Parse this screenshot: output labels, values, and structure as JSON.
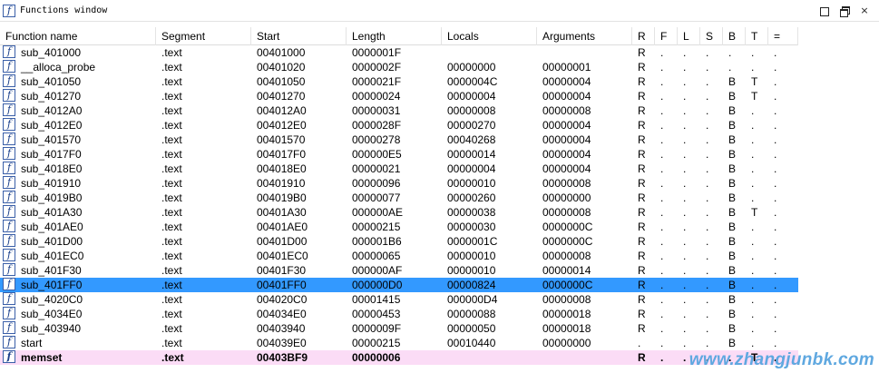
{
  "window": {
    "title": "Functions window",
    "title_icon_glyph": "f",
    "controls": [
      "minimize",
      "restore",
      "close"
    ],
    "close_glyph": "×"
  },
  "columns": [
    "Function name",
    "Segment",
    "Start",
    "Length",
    "Locals",
    "Arguments",
    "R",
    "F",
    "L",
    "S",
    "B",
    "T",
    "="
  ],
  "rows": [
    {
      "name": "sub_401000",
      "segment": ".text",
      "start": "00401000",
      "length": "0000001F",
      "locals": "",
      "arguments": "",
      "R": "R",
      "F": ".",
      "L": ".",
      "S": ".",
      "B": ".",
      "T": ".",
      "eq": "."
    },
    {
      "name": "__alloca_probe",
      "segment": ".text",
      "start": "00401020",
      "length": "0000002F",
      "locals": "00000000",
      "arguments": "00000001",
      "R": "R",
      "F": ".",
      "L": ".",
      "S": ".",
      "B": ".",
      "T": ".",
      "eq": "."
    },
    {
      "name": "sub_401050",
      "segment": ".text",
      "start": "00401050",
      "length": "0000021F",
      "locals": "0000004C",
      "arguments": "00000004",
      "R": "R",
      "F": ".",
      "L": ".",
      "S": ".",
      "B": "B",
      "T": "T",
      "eq": "."
    },
    {
      "name": "sub_401270",
      "segment": ".text",
      "start": "00401270",
      "length": "00000024",
      "locals": "00000004",
      "arguments": "00000004",
      "R": "R",
      "F": ".",
      "L": ".",
      "S": ".",
      "B": "B",
      "T": "T",
      "eq": "."
    },
    {
      "name": "sub_4012A0",
      "segment": ".text",
      "start": "004012A0",
      "length": "00000031",
      "locals": "00000008",
      "arguments": "00000008",
      "R": "R",
      "F": ".",
      "L": ".",
      "S": ".",
      "B": "B",
      "T": ".",
      "eq": "."
    },
    {
      "name": "sub_4012E0",
      "segment": ".text",
      "start": "004012E0",
      "length": "0000028F",
      "locals": "00000270",
      "arguments": "00000004",
      "R": "R",
      "F": ".",
      "L": ".",
      "S": ".",
      "B": "B",
      "T": ".",
      "eq": "."
    },
    {
      "name": "sub_401570",
      "segment": ".text",
      "start": "00401570",
      "length": "00000278",
      "locals": "00040268",
      "arguments": "00000004",
      "R": "R",
      "F": ".",
      "L": ".",
      "S": ".",
      "B": "B",
      "T": ".",
      "eq": "."
    },
    {
      "name": "sub_4017F0",
      "segment": ".text",
      "start": "004017F0",
      "length": "000000E5",
      "locals": "00000014",
      "arguments": "00000004",
      "R": "R",
      "F": ".",
      "L": ".",
      "S": ".",
      "B": "B",
      "T": ".",
      "eq": "."
    },
    {
      "name": "sub_4018E0",
      "segment": ".text",
      "start": "004018E0",
      "length": "00000021",
      "locals": "00000004",
      "arguments": "00000004",
      "R": "R",
      "F": ".",
      "L": ".",
      "S": ".",
      "B": "B",
      "T": ".",
      "eq": "."
    },
    {
      "name": "sub_401910",
      "segment": ".text",
      "start": "00401910",
      "length": "00000096",
      "locals": "00000010",
      "arguments": "00000008",
      "R": "R",
      "F": ".",
      "L": ".",
      "S": ".",
      "B": "B",
      "T": ".",
      "eq": "."
    },
    {
      "name": "sub_4019B0",
      "segment": ".text",
      "start": "004019B0",
      "length": "00000077",
      "locals": "00000260",
      "arguments": "00000000",
      "R": "R",
      "F": ".",
      "L": ".",
      "S": ".",
      "B": "B",
      "T": ".",
      "eq": "."
    },
    {
      "name": "sub_401A30",
      "segment": ".text",
      "start": "00401A30",
      "length": "000000AE",
      "locals": "00000038",
      "arguments": "00000008",
      "R": "R",
      "F": ".",
      "L": ".",
      "S": ".",
      "B": "B",
      "T": "T",
      "eq": "."
    },
    {
      "name": "sub_401AE0",
      "segment": ".text",
      "start": "00401AE0",
      "length": "00000215",
      "locals": "00000030",
      "arguments": "0000000C",
      "R": "R",
      "F": ".",
      "L": ".",
      "S": ".",
      "B": "B",
      "T": ".",
      "eq": "."
    },
    {
      "name": "sub_401D00",
      "segment": ".text",
      "start": "00401D00",
      "length": "000001B6",
      "locals": "0000001C",
      "arguments": "0000000C",
      "R": "R",
      "F": ".",
      "L": ".",
      "S": ".",
      "B": "B",
      "T": ".",
      "eq": "."
    },
    {
      "name": "sub_401EC0",
      "segment": ".text",
      "start": "00401EC0",
      "length": "00000065",
      "locals": "00000010",
      "arguments": "00000008",
      "R": "R",
      "F": ".",
      "L": ".",
      "S": ".",
      "B": "B",
      "T": ".",
      "eq": "."
    },
    {
      "name": "sub_401F30",
      "segment": ".text",
      "start": "00401F30",
      "length": "000000AF",
      "locals": "00000010",
      "arguments": "00000014",
      "R": "R",
      "F": ".",
      "L": ".",
      "S": ".",
      "B": "B",
      "T": ".",
      "eq": "."
    },
    {
      "name": "sub_401FF0",
      "segment": ".text",
      "start": "00401FF0",
      "length": "000000D0",
      "locals": "00000824",
      "arguments": "0000000C",
      "R": "R",
      "F": ".",
      "L": ".",
      "S": ".",
      "B": "B",
      "T": ".",
      "eq": ".",
      "selected": true
    },
    {
      "name": "sub_4020C0",
      "segment": ".text",
      "start": "004020C0",
      "length": "00001415",
      "locals": "000000D4",
      "arguments": "00000008",
      "R": "R",
      "F": ".",
      "L": ".",
      "S": ".",
      "B": "B",
      "T": ".",
      "eq": "."
    },
    {
      "name": "sub_4034E0",
      "segment": ".text",
      "start": "004034E0",
      "length": "00000453",
      "locals": "00000088",
      "arguments": "00000018",
      "R": "R",
      "F": ".",
      "L": ".",
      "S": ".",
      "B": "B",
      "T": ".",
      "eq": "."
    },
    {
      "name": "sub_403940",
      "segment": ".text",
      "start": "00403940",
      "length": "0000009F",
      "locals": "00000050",
      "arguments": "00000018",
      "R": "R",
      "F": ".",
      "L": ".",
      "S": ".",
      "B": "B",
      "T": ".",
      "eq": "."
    },
    {
      "name": "start",
      "segment": ".text",
      "start": "004039E0",
      "length": "00000215",
      "locals": "00010440",
      "arguments": "00000000",
      "R": ".",
      "F": ".",
      "L": ".",
      "S": ".",
      "B": "B",
      "T": ".",
      "eq": "."
    },
    {
      "name": "memset",
      "segment": ".text",
      "start": "00403BF9",
      "length": "00000006",
      "locals": "",
      "arguments": "",
      "R": "R",
      "F": ".",
      "L": ".",
      "S": ".",
      "B": ".",
      "T": "T",
      "eq": ".",
      "highlight": true
    }
  ],
  "colors": {
    "selected_row": "#3399ff",
    "library_row": "#fbdcf6",
    "watermark": "#5fa8e0"
  },
  "icons": {
    "function": "function-icon"
  },
  "watermark": "www.zhangjunbk.com"
}
